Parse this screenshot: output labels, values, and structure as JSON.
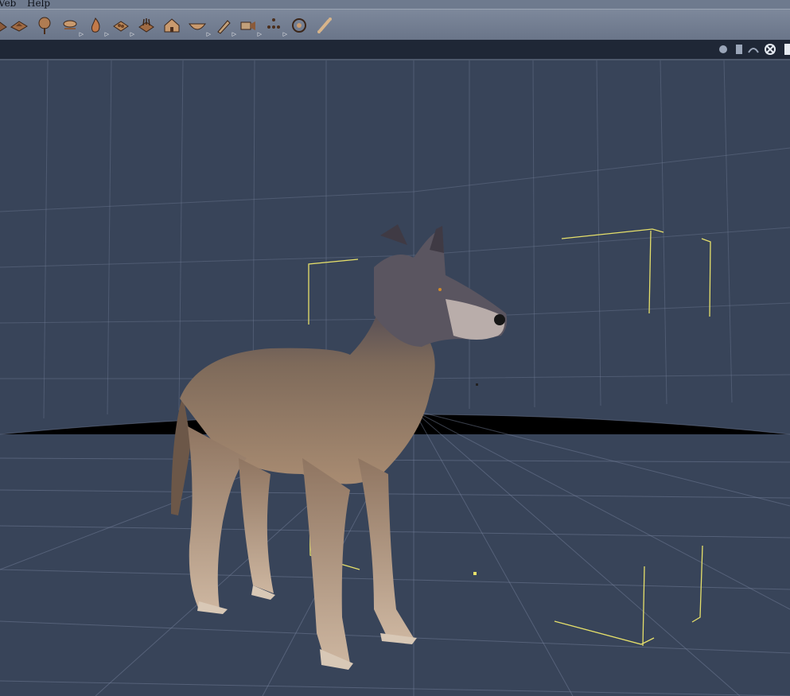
{
  "menu": {
    "items": [
      "Web",
      "Help"
    ],
    "visible_web": "Veb"
  },
  "toolbar": {
    "tools": [
      {
        "name": "lights-icon",
        "has_menu": false
      },
      {
        "name": "terrain-icon",
        "has_menu": false
      },
      {
        "name": "tree-icon",
        "has_menu": false
      },
      {
        "name": "cloud-icon",
        "has_menu": true
      },
      {
        "name": "fire-icon",
        "has_menu": true
      },
      {
        "name": "plant-icon",
        "has_menu": true
      },
      {
        "name": "grass-icon",
        "has_menu": false
      },
      {
        "name": "house-icon",
        "has_menu": false
      },
      {
        "name": "bowl-icon",
        "has_menu": true
      },
      {
        "name": "hair-brush-icon",
        "has_menu": true
      },
      {
        "name": "camera-icon",
        "has_menu": true
      },
      {
        "name": "particles-icon",
        "has_menu": true
      },
      {
        "name": "target-icon",
        "has_menu": false
      },
      {
        "name": "bone-icon",
        "has_menu": false
      }
    ]
  },
  "viewport_controls": [
    {
      "name": "light-view-icon"
    },
    {
      "name": "camera-list-icon"
    },
    {
      "name": "figure-view-icon"
    },
    {
      "name": "render-wheel-icon"
    }
  ],
  "colors": {
    "viewport_bg": "#384459",
    "grid": "#7a86a0",
    "bbox": "#e6e06a",
    "toolbar": "#747f92"
  },
  "scene": {
    "subject": "wolf figure"
  }
}
